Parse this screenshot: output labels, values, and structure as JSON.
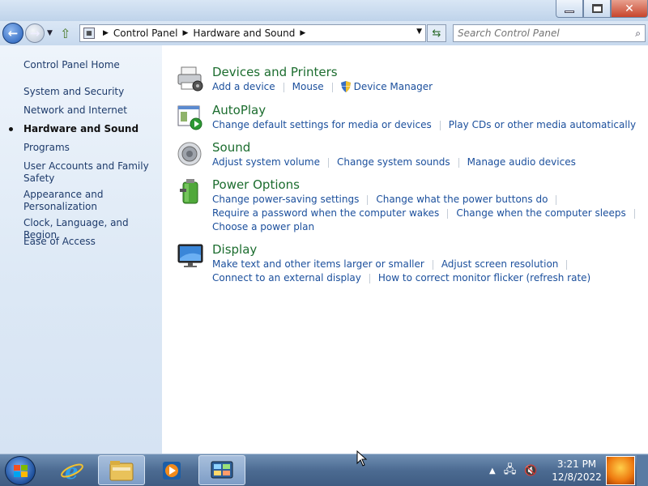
{
  "window": {
    "buttons": {
      "minimize": "minimize",
      "maximize": "restore",
      "close": "close"
    }
  },
  "navigation": {
    "breadcrumb": [
      "Control Panel",
      "Hardware and Sound"
    ],
    "search_placeholder": "Search Control Panel"
  },
  "sidebar": {
    "home": "Control Panel Home",
    "items": [
      {
        "label": "System and Security",
        "current": false
      },
      {
        "label": "Network and Internet",
        "current": false
      },
      {
        "label": "Hardware and Sound",
        "current": true
      },
      {
        "label": "Programs",
        "current": false
      },
      {
        "label": "User Accounts and Family Safety",
        "current": false
      },
      {
        "label": "Appearance and Personalization",
        "current": false
      },
      {
        "label": "Clock, Language, and Region",
        "current": false
      },
      {
        "label": "Ease of Access",
        "current": false
      }
    ]
  },
  "categories": [
    {
      "title": "Devices and Printers",
      "icon": "printer-icon",
      "rows": [
        [
          "Add a device",
          "Mouse",
          "Device Manager"
        ]
      ]
    },
    {
      "title": "AutoPlay",
      "icon": "autoplay-icon",
      "rows": [
        [
          "Change default settings for media or devices",
          "Play CDs or other media automatically"
        ]
      ]
    },
    {
      "title": "Sound",
      "icon": "speaker-icon",
      "rows": [
        [
          "Adjust system volume",
          "Change system sounds",
          "Manage audio devices"
        ]
      ]
    },
    {
      "title": "Power Options",
      "icon": "battery-icon",
      "rows": [
        [
          "Change power-saving settings",
          "Change what the power buttons do"
        ],
        [
          "Require a password when the computer wakes",
          "Change when the computer sleeps"
        ],
        [
          "Choose a power plan"
        ]
      ]
    },
    {
      "title": "Display",
      "icon": "monitor-icon",
      "rows": [
        [
          "Make text and other items larger or smaller",
          "Adjust screen resolution"
        ],
        [
          "Connect to an external display",
          "How to correct monitor flicker (refresh rate)"
        ]
      ]
    }
  ],
  "taskbar": {
    "clock_time": "3:21 PM",
    "clock_date": "12/8/2022"
  },
  "colors": {
    "link": "#1b4f9c",
    "category_title": "#1c6d2f",
    "sidebar_link": "#1e3b6b"
  }
}
